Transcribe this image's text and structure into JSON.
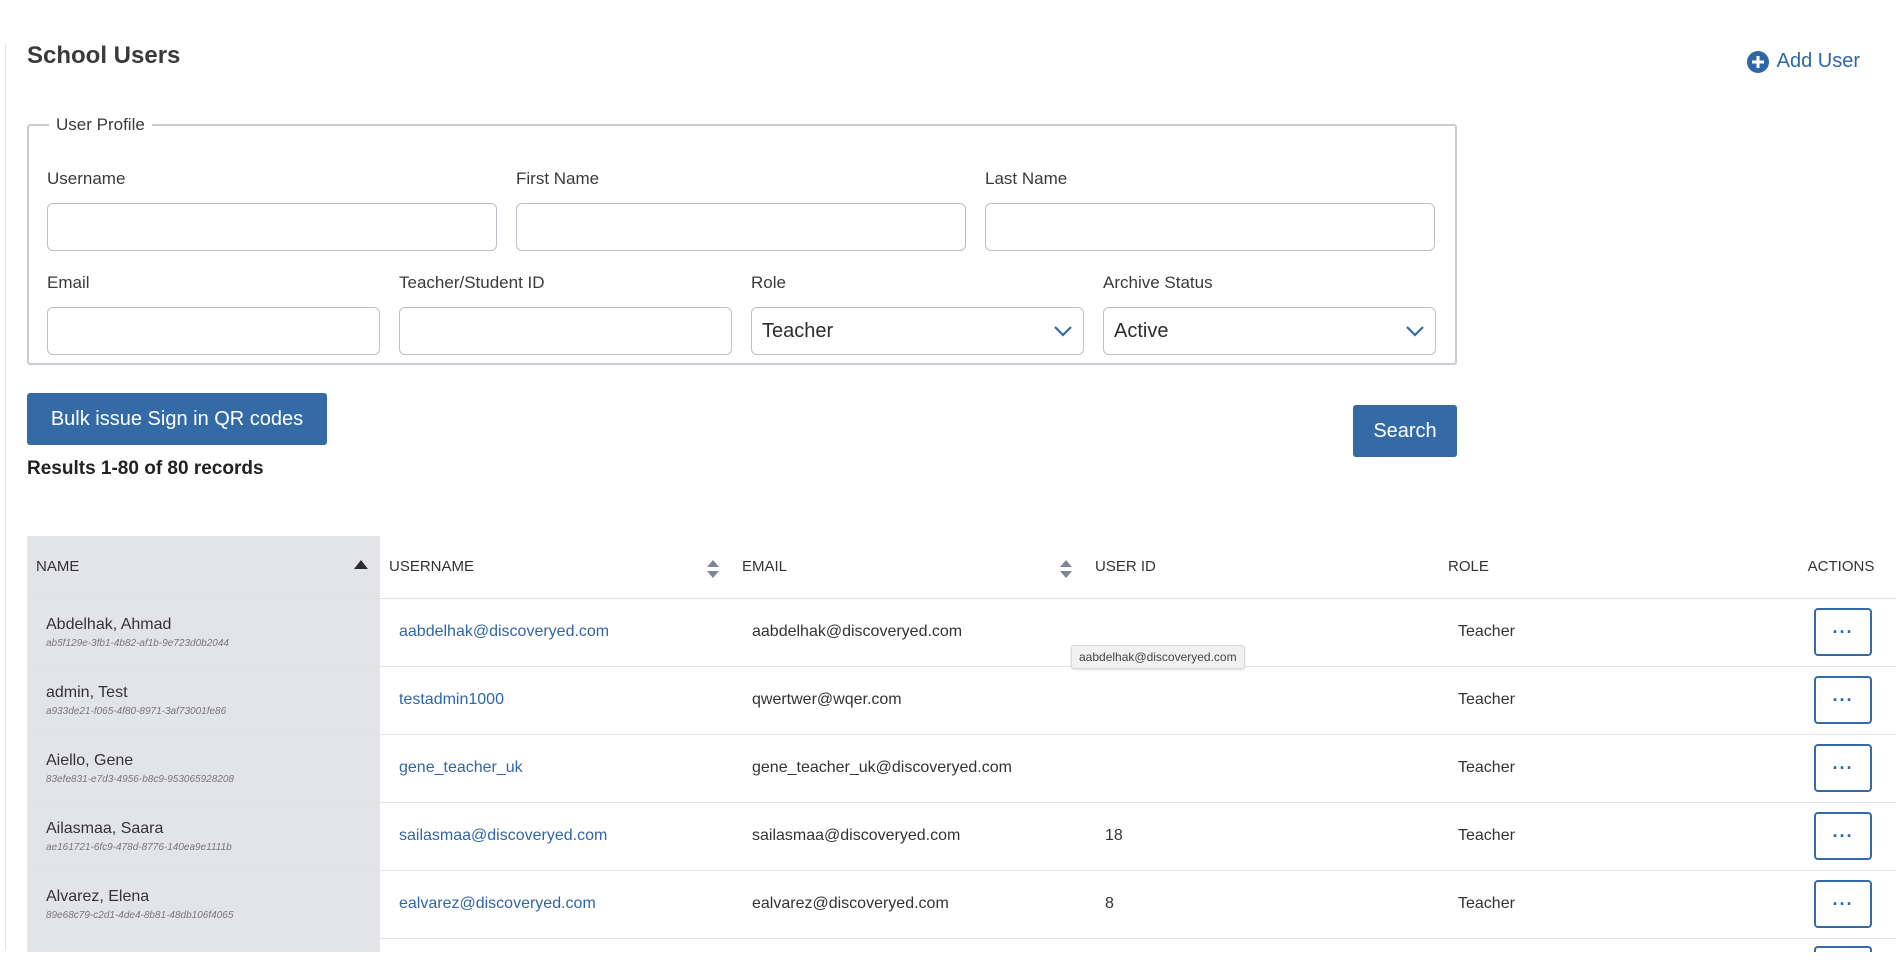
{
  "page": {
    "title": "School Users"
  },
  "header": {
    "add_user_label": "Add User"
  },
  "profile": {
    "legend": "User Profile",
    "username": {
      "label": "Username",
      "value": ""
    },
    "first_name": {
      "label": "First Name",
      "value": ""
    },
    "last_name": {
      "label": "Last Name",
      "value": ""
    },
    "email": {
      "label": "Email",
      "value": ""
    },
    "teacher_student_id": {
      "label": "Teacher/Student ID",
      "value": ""
    },
    "role": {
      "label": "Role",
      "selected": "Teacher"
    },
    "archive_status": {
      "label": "Archive Status",
      "selected": "Active"
    }
  },
  "actions": {
    "bulk_label": "Bulk issue Sign in QR codes",
    "search_label": "Search"
  },
  "results": {
    "summary": "Results 1-80 of 80 records"
  },
  "table": {
    "columns": {
      "name": "NAME",
      "username": "USERNAME",
      "email": "EMAIL",
      "user_id": "USER ID",
      "role": "ROLE",
      "actions": "ACTIONS"
    },
    "rows": [
      {
        "name": "Abdelhak, Ahmad",
        "uuid": "ab5f129e-3fb1-4b82-af1b-9e723d0b2044",
        "username": "aabdelhak@discoveryed.com",
        "email": "aabdelhak@discoveryed.com",
        "user_id": "",
        "role": "Teacher",
        "action_label": "···"
      },
      {
        "name": "admin, Test",
        "uuid": "a933de21-f065-4f80-8971-3af73001fe86",
        "username": "testadmin1000",
        "email": "qwertwer@wqer.com",
        "user_id": "",
        "role": "Teacher",
        "action_label": "···"
      },
      {
        "name": "Aiello, Gene",
        "uuid": "83efe831-e7d3-4956-b8c9-953065928208",
        "username": "gene_teacher_uk",
        "email": "gene_teacher_uk@discoveryed.com",
        "user_id": "",
        "role": "Teacher",
        "action_label": "···"
      },
      {
        "name": "Ailasmaa, Saara",
        "uuid": "ae161721-6fc9-478d-8776-140ea9e1111b",
        "username": "sailasmaa@discoveryed.com",
        "email": "sailasmaa@discoveryed.com",
        "user_id": "18",
        "role": "Teacher",
        "action_label": "···"
      },
      {
        "name": "Alvarez, Elena",
        "uuid": "89e68c79-c2d1-4de4-8b81-48db106f4065",
        "username": "ealvarez@discoveryed.com",
        "email": "ealvarez@discoveryed.com",
        "user_id": "8",
        "role": "Teacher",
        "action_label": "···"
      }
    ]
  },
  "tooltip": {
    "text": "aabdelhak@discoveryed.com"
  },
  "icons": {
    "add": "plus-circle-icon",
    "dropdown": "chevron-down-icon",
    "sort_ascending": "sort-ascending-icon",
    "sortable": "sort-both-icon"
  },
  "colors": {
    "accent": "#346ba6",
    "link": "#2f66a6",
    "name_column_bg": "#e3e4e7"
  }
}
